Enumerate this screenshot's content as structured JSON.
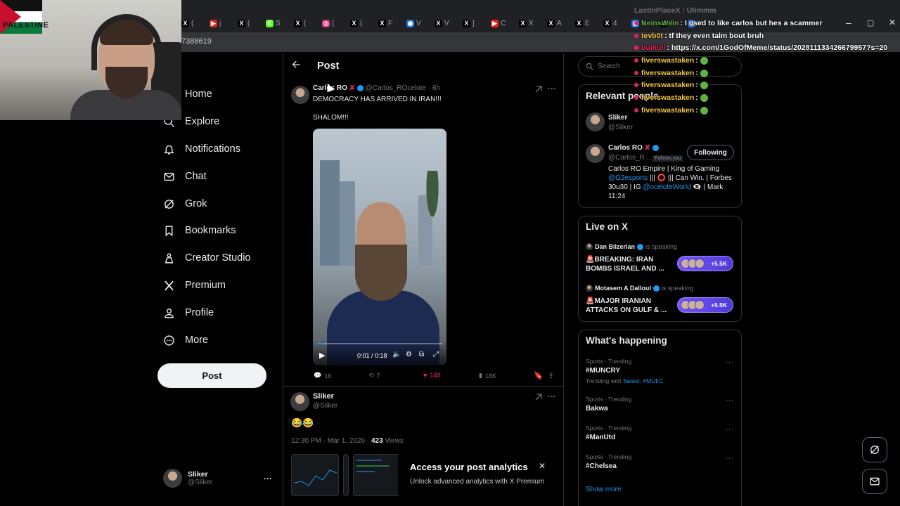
{
  "browser": {
    "tabs": [
      {
        "icon": "x-icon",
        "label": "(",
        "color": "#000000",
        "glyph": "X"
      },
      {
        "icon": "youtube-icon",
        "label": "j",
        "color": "#e62117",
        "glyph": "▶"
      },
      {
        "icon": "x-icon",
        "label": "(",
        "color": "#000000",
        "glyph": "X"
      },
      {
        "icon": "kick-icon",
        "label": "S",
        "color": "#53fc18",
        "glyph": "K"
      },
      {
        "icon": "x-icon",
        "label": "(",
        "color": "#000000",
        "glyph": "X"
      },
      {
        "icon": "instagram-icon",
        "label": "(",
        "color": "#d62976",
        "glyph": "◎"
      },
      {
        "icon": "x-icon",
        "label": "(",
        "color": "#000000",
        "glyph": "X"
      },
      {
        "icon": "x-icon",
        "label": "F",
        "color": "#000000",
        "glyph": "X"
      },
      {
        "icon": "globe-icon",
        "label": "V",
        "color": "#1a73e8",
        "glyph": "◉"
      },
      {
        "icon": "x-icon",
        "label": "V",
        "color": "#000000",
        "glyph": "X"
      },
      {
        "icon": "x-icon",
        "label": "]",
        "color": "#000000",
        "glyph": "X"
      },
      {
        "icon": "youtube-icon",
        "label": "C",
        "color": "#e62117",
        "glyph": "▶"
      },
      {
        "icon": "x-icon",
        "label": "X",
        "color": "#000000",
        "glyph": "X"
      },
      {
        "icon": "x-icon",
        "label": "A",
        "color": "#000000",
        "glyph": "X"
      },
      {
        "icon": "x-icon",
        "label": "E",
        "color": "#000000",
        "glyph": "X"
      },
      {
        "icon": "x-icon",
        "label": "4",
        "color": "#000000",
        "glyph": "X"
      },
      {
        "icon": "globe-icon",
        "label": "V",
        "color": "#1a73e8",
        "glyph": "◉"
      },
      {
        "icon": "x-icon",
        "label": "J",
        "color": "#000000",
        "glyph": "X"
      },
      {
        "icon": "globe-icon",
        "label": "V",
        "color": "#1a73e8",
        "glyph": "◉"
      }
    ],
    "url_fragment": "7388619",
    "window_controls": {
      "minimize": "–",
      "maximize": "▢",
      "close": "✕"
    }
  },
  "webcam": {
    "flag_text": "PALESTINE"
  },
  "chat": {
    "top_line": {
      "user": "LastInPlaceX",
      "msg": "Uhmmm"
    },
    "lines": [
      {
        "user": "NeinsWein",
        "user_color": "#5fb244",
        "msg": "I used to like carlos but hes a scammer"
      },
      {
        "user": "tevb0t",
        "user_color": "#f5c542",
        "msg": "tf they even talm bout bruh"
      },
      {
        "user": "builtoli",
        "user_color": "#e0245e",
        "msg": "https://x.com/1GodOfMeme/status/202811133426679957?s=20"
      },
      {
        "user": "fiverswastaken",
        "user_color": "#f5c542",
        "msg": ""
      },
      {
        "user": "fiverswastaken",
        "user_color": "#f5c542",
        "msg": ""
      },
      {
        "user": "fiverswastaken",
        "user_color": "#f5c542",
        "msg": ""
      },
      {
        "user": "fiverswastaken",
        "user_color": "#f5c542",
        "msg": ""
      },
      {
        "user": "fiverswastaken",
        "user_color": "#f5c542",
        "msg": ""
      }
    ]
  },
  "nav": {
    "items": [
      {
        "label": "Home",
        "icon": "home-icon"
      },
      {
        "label": "Explore",
        "icon": "search-icon"
      },
      {
        "label": "Notifications",
        "icon": "bell-icon"
      },
      {
        "label": "Chat",
        "icon": "mail-icon"
      },
      {
        "label": "Grok",
        "icon": "grok-icon"
      },
      {
        "label": "Bookmarks",
        "icon": "bookmark-icon"
      },
      {
        "label": "Creator Studio",
        "icon": "creator-studio-icon"
      },
      {
        "label": "Premium",
        "icon": "x-logo-icon"
      },
      {
        "label": "Profile",
        "icon": "person-icon"
      },
      {
        "label": "More",
        "icon": "more-circle-icon"
      }
    ],
    "post_button": "Post",
    "account": {
      "name": "Sliker",
      "handle": "@Sliker",
      "more": "···"
    }
  },
  "main": {
    "header_title": "Post",
    "quoted": {
      "name": "Carlos RO",
      "badge": "✘",
      "handle": "@Carlos_ROcelote",
      "time": "· 6h",
      "line1": "DEMOCRACY HAS ARRIVED IN IRAN!!!",
      "line2": "SHALOM!!!",
      "video_time": "0:01 / 0:18",
      "video_progress": 0.06,
      "stats": {
        "replies": "16",
        "reposts": "7",
        "likes": "148",
        "views": "18K"
      }
    },
    "reply": {
      "name": "Sliker",
      "handle": "@Sliker",
      "emojis": "😂😂",
      "timestamp": "12:30 PM · Mar 1, 2026 · ",
      "views_count": "423",
      "views_label": " Views"
    },
    "analytics": {
      "title": "Access your post analytics",
      "subtitle": "Unlock advanced analytics with X Premium",
      "close": "✕"
    }
  },
  "right": {
    "search_placeholder": "Search",
    "relevant": {
      "title": "Relevant people",
      "people": [
        {
          "name": "Sliker",
          "handle": "@Sliker"
        },
        {
          "name": "Carlos RO",
          "badge": "✘",
          "handle": "@Carlos_R...",
          "follows_you": "Follows you",
          "button": "Following"
        }
      ],
      "bio_parts": {
        "a": "Carlos RO Empire | King of Gaming ",
        "link1": "@G2esports",
        "b": " ||| ⭕ ||| Can Win. | Forbes 30u30 | IG ",
        "link2": "@oceloteWorld",
        "c": " 👁‍🗨 | Mark 11:24"
      }
    },
    "live": {
      "title": "Live on X",
      "spaces": [
        {
          "host": "Dan Bilzerian",
          "speaking": "is speaking",
          "title": "🚨BREAKING: IRAN BOMBS ISRAEL AND ...",
          "count": "+5.5K"
        },
        {
          "host": "Motasem A Dalloul",
          "speaking": "is speaking",
          "title": "🚨MAJOR IRANIAN ATTACKS ON GULF & ...",
          "count": "+5.5K"
        }
      ]
    },
    "happening": {
      "title": "What's happening",
      "trends": [
        {
          "category": "Sports · Trending",
          "name": "#MUNCRY",
          "with_label": "Trending with ",
          "with_links": "Sesko, #MUFC"
        },
        {
          "category": "Sports · Trending",
          "name": "Bakwa"
        },
        {
          "category": "Sports · Trending",
          "name": "#ManUtd"
        },
        {
          "category": "Sports · Trending",
          "name": "#Chelsea"
        }
      ],
      "show_more": "Show more"
    }
  },
  "colors": {
    "accent": "#1d9bf0",
    "like": "#f91880",
    "border": "#2f3336",
    "muted": "#71767b"
  }
}
